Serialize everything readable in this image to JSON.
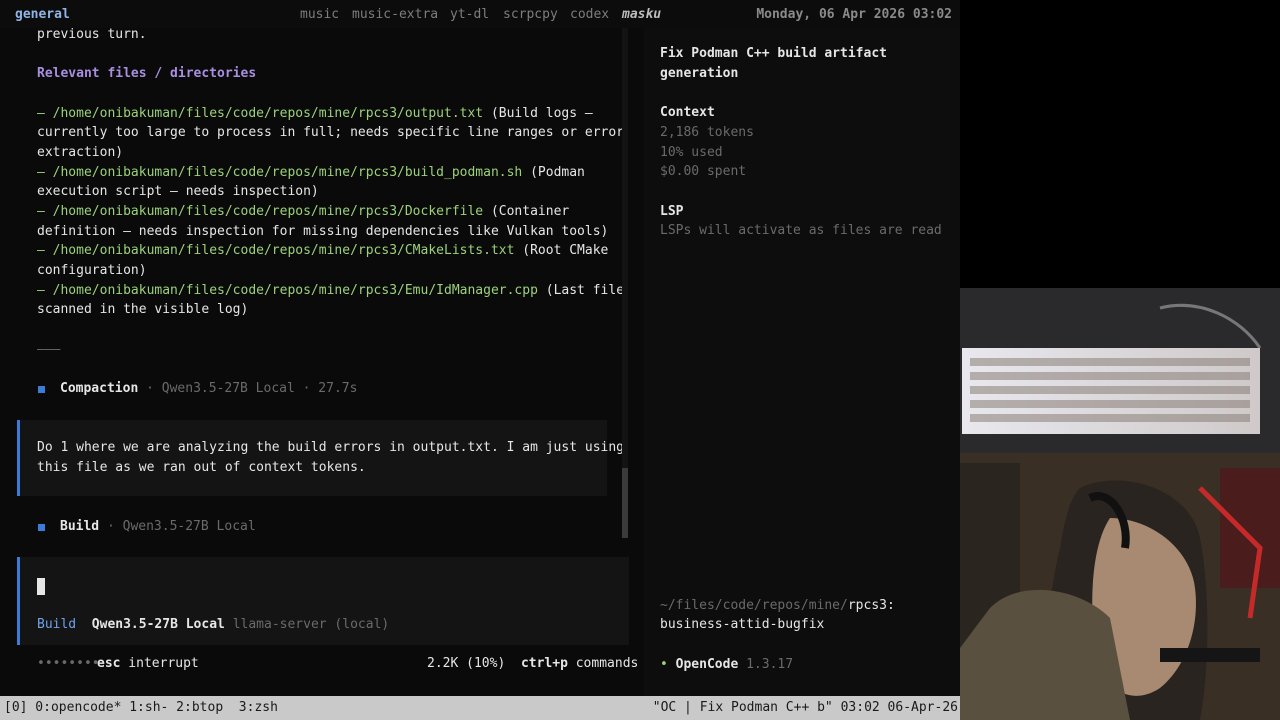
{
  "topbar": {
    "active": "general",
    "workspaces": [
      "music",
      "music-extra",
      "yt-dl",
      "scrpcpy",
      "codex"
    ],
    "current": "masku",
    "datetime": "Monday, 06 Apr 2026 03:02"
  },
  "chat": {
    "prev_tail": "previous turn.",
    "heading": "Relevant files / directories",
    "files": [
      {
        "path": "/home/onibakuman/files/code/repos/mine/rpcs3/output.txt",
        "desc_first": " (Build logs –",
        "desc_rest": "currently too large to process in full; needs specific line ranges or error",
        "desc_rest2": "extraction)"
      },
      {
        "path": "/home/onibakuman/files/code/repos/mine/rpcs3/build_podman.sh",
        "desc_first": " (Podman",
        "desc_rest": "execution script – needs inspection)"
      },
      {
        "path": "/home/onibakuman/files/code/repos/mine/rpcs3/Dockerfile",
        "desc_first": " (Container",
        "desc_rest": "definition – needs inspection for missing dependencies like Vulkan tools)"
      },
      {
        "path": "/home/onibakuman/files/code/repos/mine/rpcs3/CMakeLists.txt",
        "desc_first": " (Root CMake",
        "desc_rest": "configuration)"
      },
      {
        "path": "/home/onibakuman/files/code/repos/mine/rpcs3/Emu/IdManager.cpp",
        "desc_first": " (Last file",
        "desc_rest": "scanned in the visible log)"
      }
    ],
    "hr": "———",
    "compaction": {
      "label": "Compaction",
      "model": " · Qwen3.5-27B Local · 27.7s"
    },
    "user_message": [
      "Do 1 where we are analyzing the build errors in output.txt. I am just using",
      "this file as we ran out of context tokens."
    ],
    "build": {
      "label": "Build",
      "model": " · Qwen3.5-27B Local"
    }
  },
  "input": {
    "mode": "Build",
    "model": "Qwen3.5-27B Local",
    "server": "llama-server (local)"
  },
  "footer": {
    "dots": "••••••••",
    "esc_key": "esc",
    "esc_label": " interrupt",
    "usage": "2.2K (10%)",
    "cmd_key": "ctrl+p",
    "cmd_label": " commands"
  },
  "sidebar": {
    "title_line1": "Fix Podman C++ build artifact",
    "title_line2": "generation",
    "context_heading": "Context",
    "tokens": "2,186 tokens",
    "used": "10% used",
    "spent": "$0.00 spent",
    "lsp_heading": "LSP",
    "lsp_text": "LSPs will activate as files are read",
    "path_prefix": "~/files/code/repos/mine/",
    "path_repo": "rpcs3:",
    "branch": "business-attid-bugfix",
    "app_bullet": "•",
    "app_name": "OpenCode",
    "app_version": " 1.3.17"
  },
  "tmux": {
    "windows": "[0] 0:opencode* 1:sh- 2:btop  3:zsh",
    "right": "\"OC | Fix Podman C++ b\" 03:02 06-Apr-26"
  },
  "colors": {
    "accent": "#3d7bd9",
    "path": "#9bd27a",
    "heading": "#a88fe0"
  }
}
